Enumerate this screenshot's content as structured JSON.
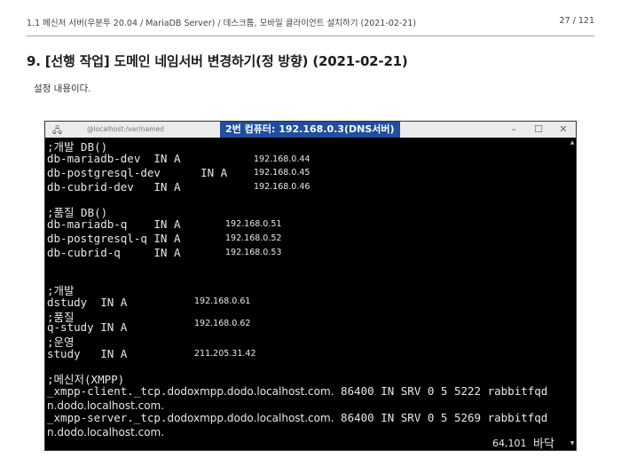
{
  "doc": {
    "header_left": "1.1 메신저 서버(우분투 20.04 / MariaDB Server) / 데스크톱, 모바일 클라이언트 설치하기 (2021-02-21)",
    "page_num": "27 / 121",
    "section_title": "9. [선행 작업] 도메인 네임서버 변경하기(정 방향) (2021-02-21)",
    "body_text": "설정 내용이다."
  },
  "terminal": {
    "title_icon": "🖧",
    "title_path": "@localhost:/var/named",
    "overlay_label": "2번 컴퓨터: 192.168.0.3(DNS서버)",
    "btn_min": "–",
    "btn_max": "☐",
    "btn_close": "✕",
    "scroll_up": "▲",
    "scroll_down": "▼",
    "lines": [
      ";개발 DB()",
      "db-mariadb-dev  IN A",
      "db-postgresql-dev      IN A",
      "db-cubrid-dev   IN A",
      ";품질 DB()",
      "db-mariadb-q    IN A",
      "db-postgresql-q IN A",
      "db-cubrid-q     IN A",
      ";개발",
      "dstudy  IN A",
      ";품질",
      "q-study IN A",
      ";운영",
      "study   IN A",
      ";메신저(XMPP)"
    ],
    "ips": [
      "192.168.0.44",
      "192.168.0.45",
      "192.168.0.46",
      "192.168.0.51",
      "192.168.0.52",
      "192.168.0.53",
      "192.168.0.61",
      "192.168.0.62",
      "211.205.31.42"
    ],
    "xmpp": [
      {
        "prefix": "_xmpp-client._tcp.",
        "domain": "dodoxmpp.dodo.localhost.com.",
        "rest": " 86400 IN SRV 0 5 5222 rabbitfqd"
      },
      {
        "prefix": "",
        "domain": "n.dodo.localhost.com.",
        "rest": ""
      },
      {
        "prefix": "_xmpp-server._tcp.",
        "domain": "dodoxmpp.dodo.localhost.com.",
        "rest": " 86400 IN SRV 0 5 5269 rabbitfqd"
      },
      {
        "prefix": "",
        "domain": "n.dodo.localhost.com.",
        "rest": ""
      }
    ],
    "status_pos": "64,101",
    "status_mode": "바닥"
  }
}
